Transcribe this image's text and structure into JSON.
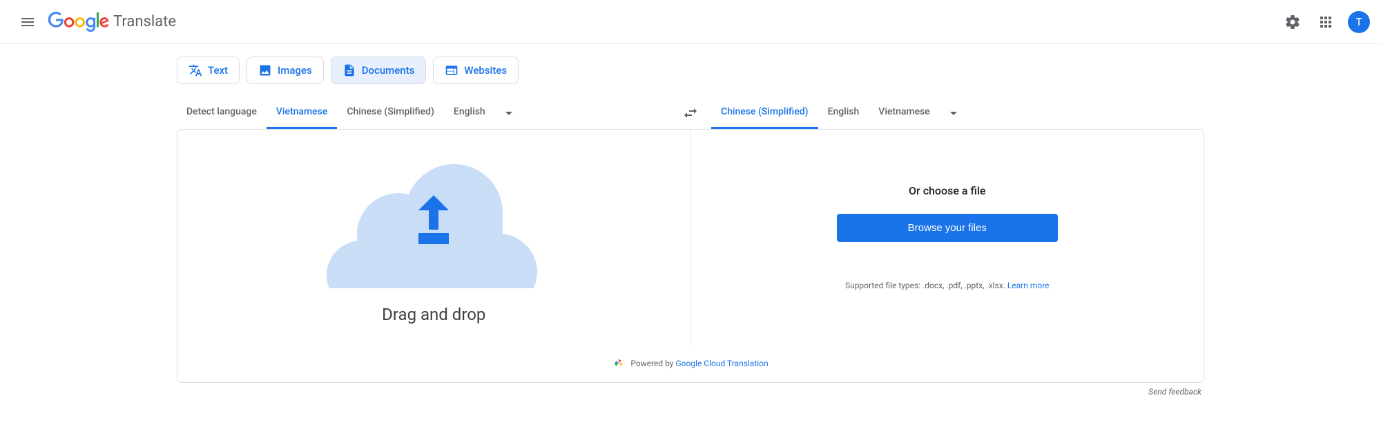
{
  "header": {
    "translate_text": "Translate",
    "avatar_initial": "T"
  },
  "modes": {
    "text": "Text",
    "images": "Images",
    "documents": "Documents",
    "websites": "Websites"
  },
  "source_langs": {
    "detect": "Detect language",
    "vietnamese": "Vietnamese",
    "chinese": "Chinese (Simplified)",
    "english": "English"
  },
  "target_langs": {
    "chinese": "Chinese (Simplified)",
    "english": "English",
    "vietnamese": "Vietnamese"
  },
  "drop": {
    "text": "Drag and drop"
  },
  "choose": {
    "title": "Or choose a file",
    "browse": "Browse your files",
    "file_types": "Supported file types: .docx, .pdf, .pptx, .xlsx. ",
    "learn_more": "Learn more"
  },
  "powered": {
    "prefix": "Powered by ",
    "link": "Google Cloud Translation"
  },
  "feedback": "Send feedback"
}
